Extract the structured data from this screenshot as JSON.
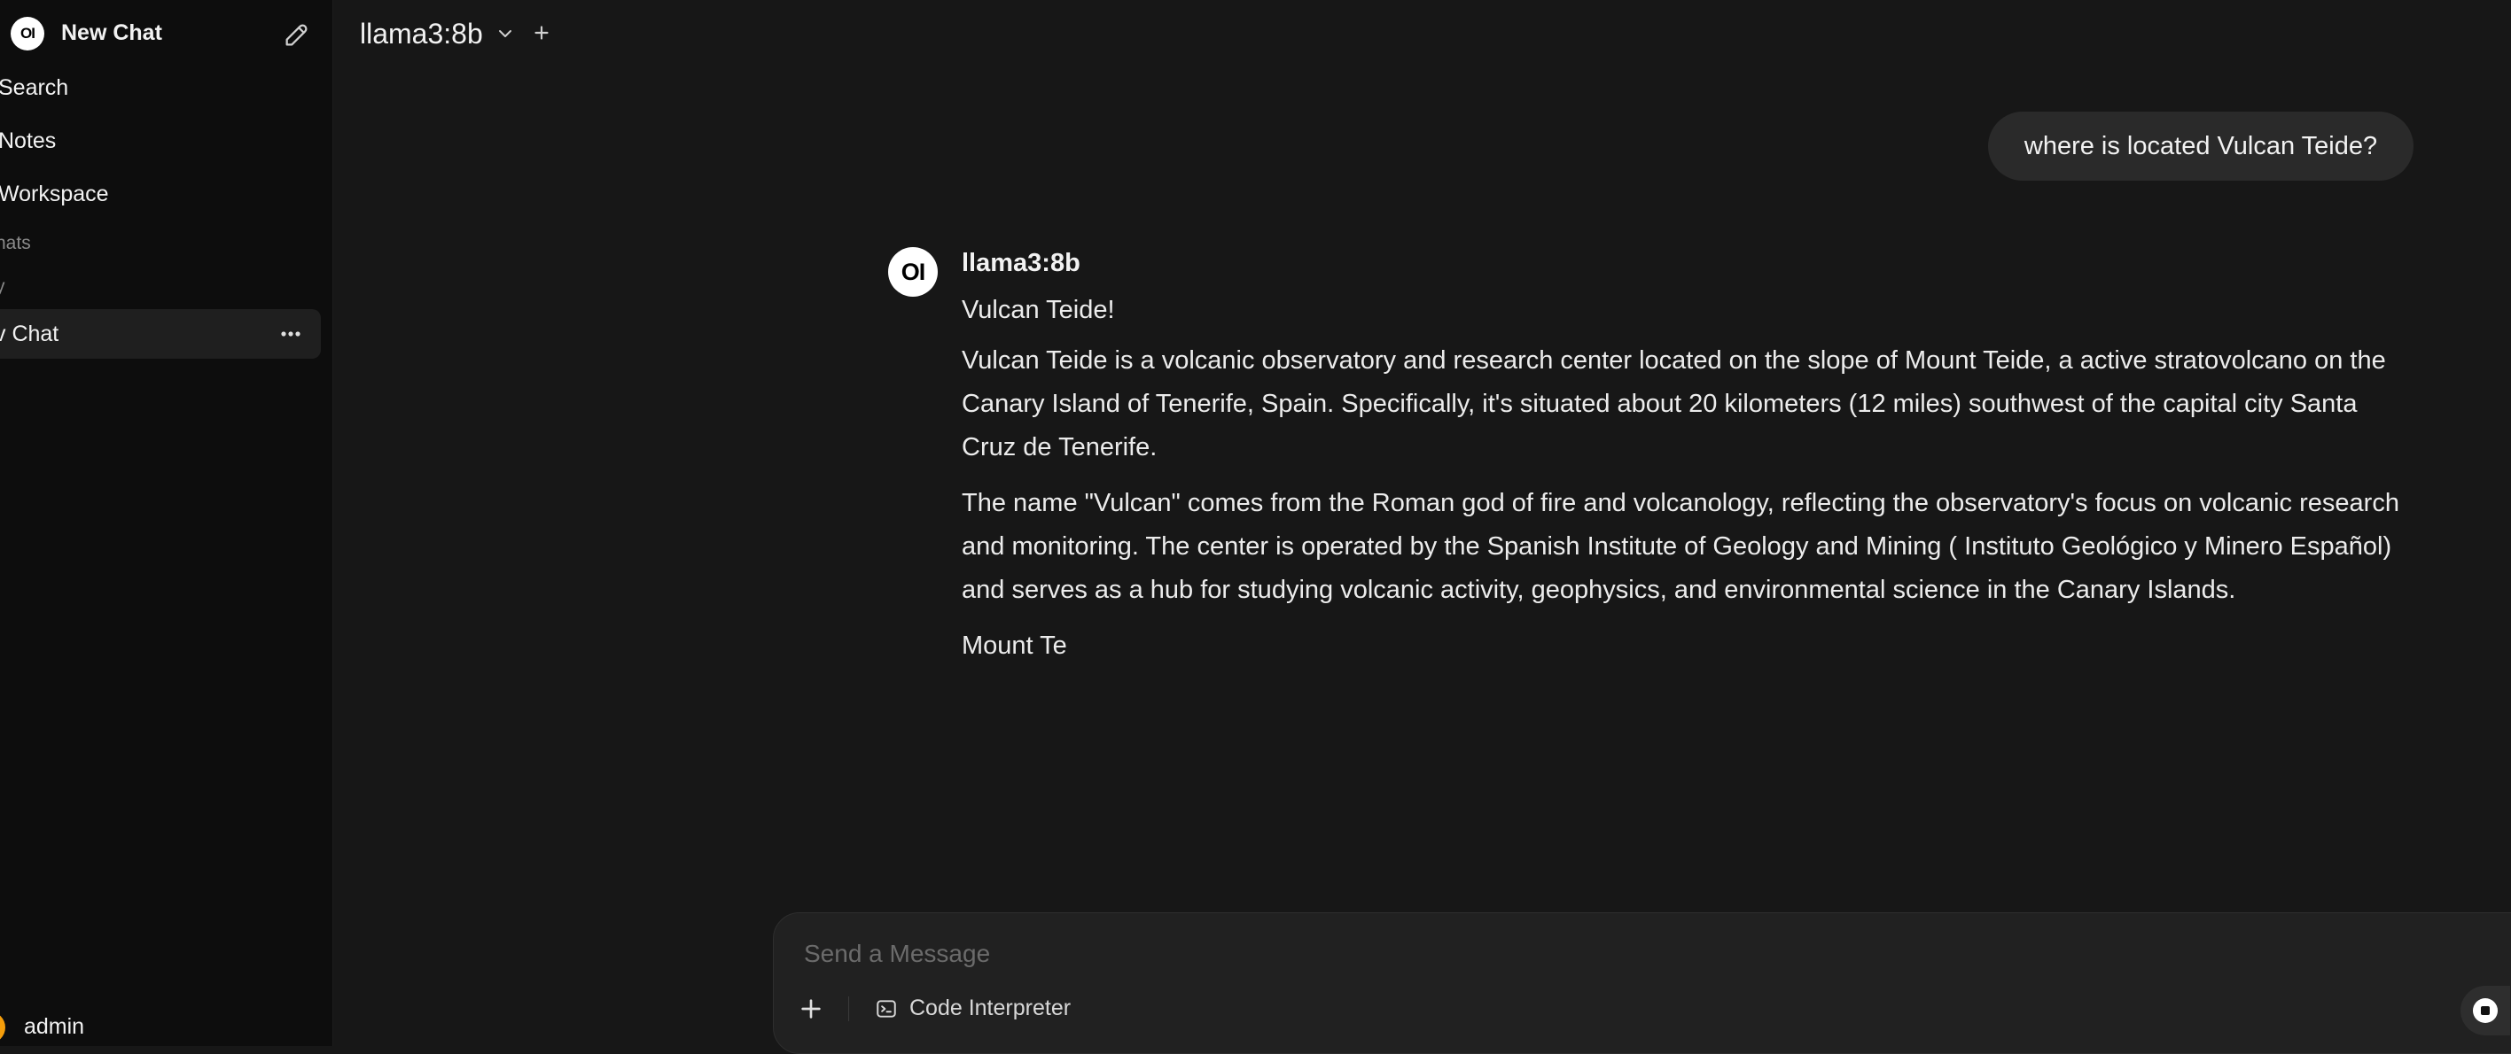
{
  "sidebar": {
    "logo_text": "OI",
    "new_chat_label": "New Chat",
    "nav": [
      {
        "label": "Search",
        "icon": "search-icon"
      },
      {
        "label": "Notes",
        "icon": "notes-icon"
      },
      {
        "label": "Workspace",
        "icon": "workspace-icon"
      }
    ],
    "section_label": "hats",
    "group_label": "y",
    "chats": [
      {
        "label": "v Chat"
      }
    ],
    "user": {
      "name": "admin",
      "avatar_color": "#f59e0b"
    }
  },
  "header": {
    "model_name": "llama3:8b"
  },
  "conversation": {
    "user_message": "where is located Vulcan Teide?",
    "assistant": {
      "avatar_text": "OI",
      "name": "llama3:8b",
      "paragraphs": [
        "Vulcan Teide!",
        "Vulcan Teide is a volcanic observatory and research center located on the slope of Mount Teide, a active stratovolcano on the Canary Island of Tenerife, Spain. Specifically, it's situated about 20 kilometers (12 miles) southwest of the capital city Santa Cruz de Tenerife.",
        "The name \"Vulcan\" comes from the Roman god of fire and volcanology, reflecting the observatory's focus on volcanic research and monitoring. The center is operated by the Spanish Institute of Geology and Mining ( Instituto Geológico y Minero Español) and serves as a hub for studying volcanic activity, geophysics, and environmental science in the Canary Islands.",
        "Mount Te"
      ]
    }
  },
  "composer": {
    "value": "",
    "placeholder": "Send a Message",
    "code_interpreter_label": "Code Interpreter"
  },
  "colors": {
    "background": "#171717",
    "sidebar": "#0d0d0d",
    "bubble": "#2a2a2a",
    "composer": "#212121",
    "accent_user": "#f59e0b"
  }
}
